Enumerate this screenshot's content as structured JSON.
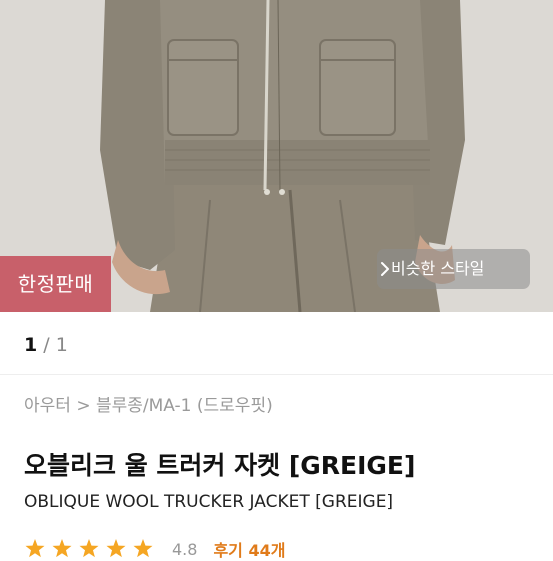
{
  "hero": {
    "badge_label": "한정판매",
    "similar_style_label": "비슷한 스타일"
  },
  "pager": {
    "current": "1",
    "separator": "/",
    "total": "1"
  },
  "breadcrumb": "아우터 > 블루종/MA-1 (드로우핏)",
  "product": {
    "title_ko": "오블리크 울 트러커 자켓 [GREIGE]",
    "title_en": "OBLIQUE WOOL TRUCKER JACKET [GREIGE]",
    "rating_score": "4.8",
    "reviews_label": "후기 44개",
    "stars": 5
  },
  "colors": {
    "badge": "#c8606a",
    "star": "#f5a623",
    "reviews": "#e07b1a"
  }
}
